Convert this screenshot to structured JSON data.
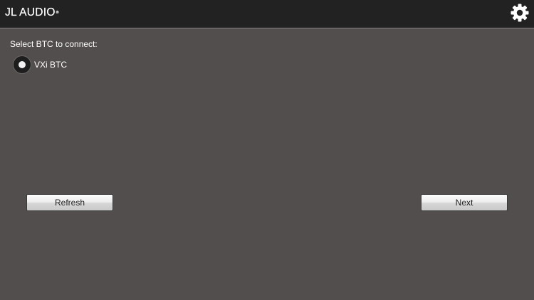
{
  "header": {
    "logo_text": "JL AUDIO",
    "logo_mark": "®",
    "settings_icon": "gear-icon"
  },
  "main": {
    "prompt": "Select BTC to connect:",
    "devices": [
      {
        "label": "VXi BTC",
        "selected": true
      }
    ]
  },
  "actions": {
    "refresh_label": "Refresh",
    "next_label": "Next"
  },
  "colors": {
    "header_bg": "#222222",
    "body_bg": "#524e4d",
    "text": "#ffffff",
    "button_text": "#1f1f1f"
  }
}
